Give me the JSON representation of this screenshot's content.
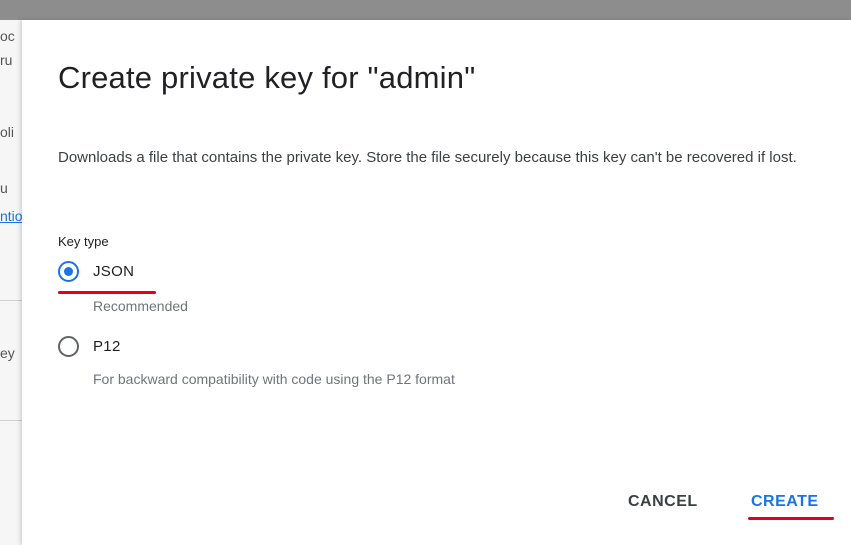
{
  "background": {
    "fragments": [
      "oc",
      "ru",
      "oli",
      "u",
      "ntio",
      "ey"
    ]
  },
  "dialog": {
    "title": "Create private key for \"admin\"",
    "description": "Downloads a file that contains the private key. Store the file securely because this key can't be recovered if lost.",
    "key_type_label": "Key type",
    "options": [
      {
        "label": "JSON",
        "helper": "Recommended",
        "selected": true
      },
      {
        "label": "P12",
        "helper": "For backward compatibility with code using the P12 format",
        "selected": false
      }
    ],
    "actions": {
      "cancel_label": "CANCEL",
      "create_label": "CREATE"
    }
  },
  "colors": {
    "accent": "#1a73e8",
    "annotation": "#e2001a",
    "title_text": "#202124",
    "helper_text": "#70757a"
  }
}
